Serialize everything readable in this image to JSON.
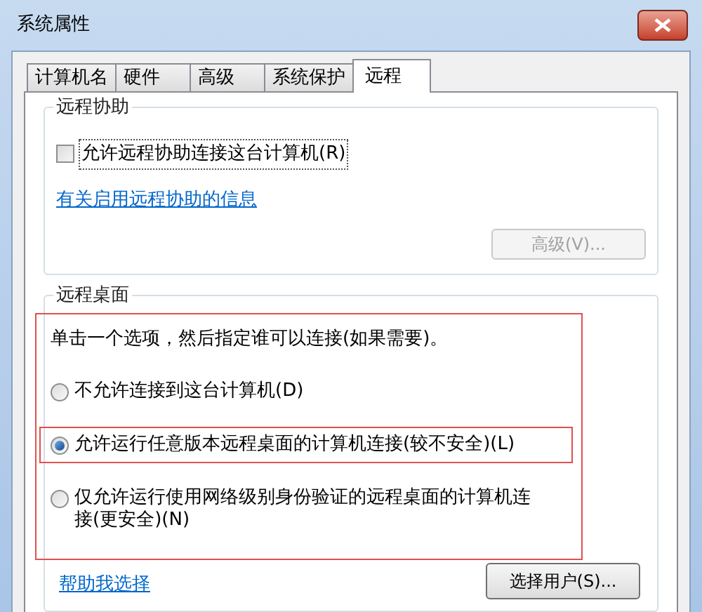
{
  "window": {
    "title": "系统属性"
  },
  "tabs": [
    {
      "label": "计算机名",
      "selected": false
    },
    {
      "label": "硬件",
      "selected": false
    },
    {
      "label": "高级",
      "selected": false
    },
    {
      "label": "系统保护",
      "selected": false
    },
    {
      "label": "远程",
      "selected": true
    }
  ],
  "remote_assistance": {
    "heading": "远程协助",
    "checkbox": {
      "label": "允许远程协助连接这台计算机(R)",
      "checked": false
    },
    "link": "有关启用远程协助的信息",
    "advanced_button": {
      "label": "高级(V)...",
      "disabled": true
    }
  },
  "remote_desktop": {
    "heading": "远程桌面",
    "highlighted": true,
    "instruction": "单击一个选项，然后指定谁可以连接(如果需要)。",
    "options": [
      {
        "label": "不允许连接到这台计算机(D)",
        "selected": false,
        "highlighted": false
      },
      {
        "label": "允许运行任意版本远程桌面的计算机连接(较不安全)(L)",
        "selected": true,
        "highlighted": true
      },
      {
        "label": "仅允许运行使用网络级别身份验证的远程桌面的计算机连接(更安全)(N)",
        "selected": false,
        "highlighted": false
      }
    ],
    "help_link": "帮助我选择",
    "users_button": {
      "label": "选择用户(S)...",
      "disabled": false
    }
  }
}
